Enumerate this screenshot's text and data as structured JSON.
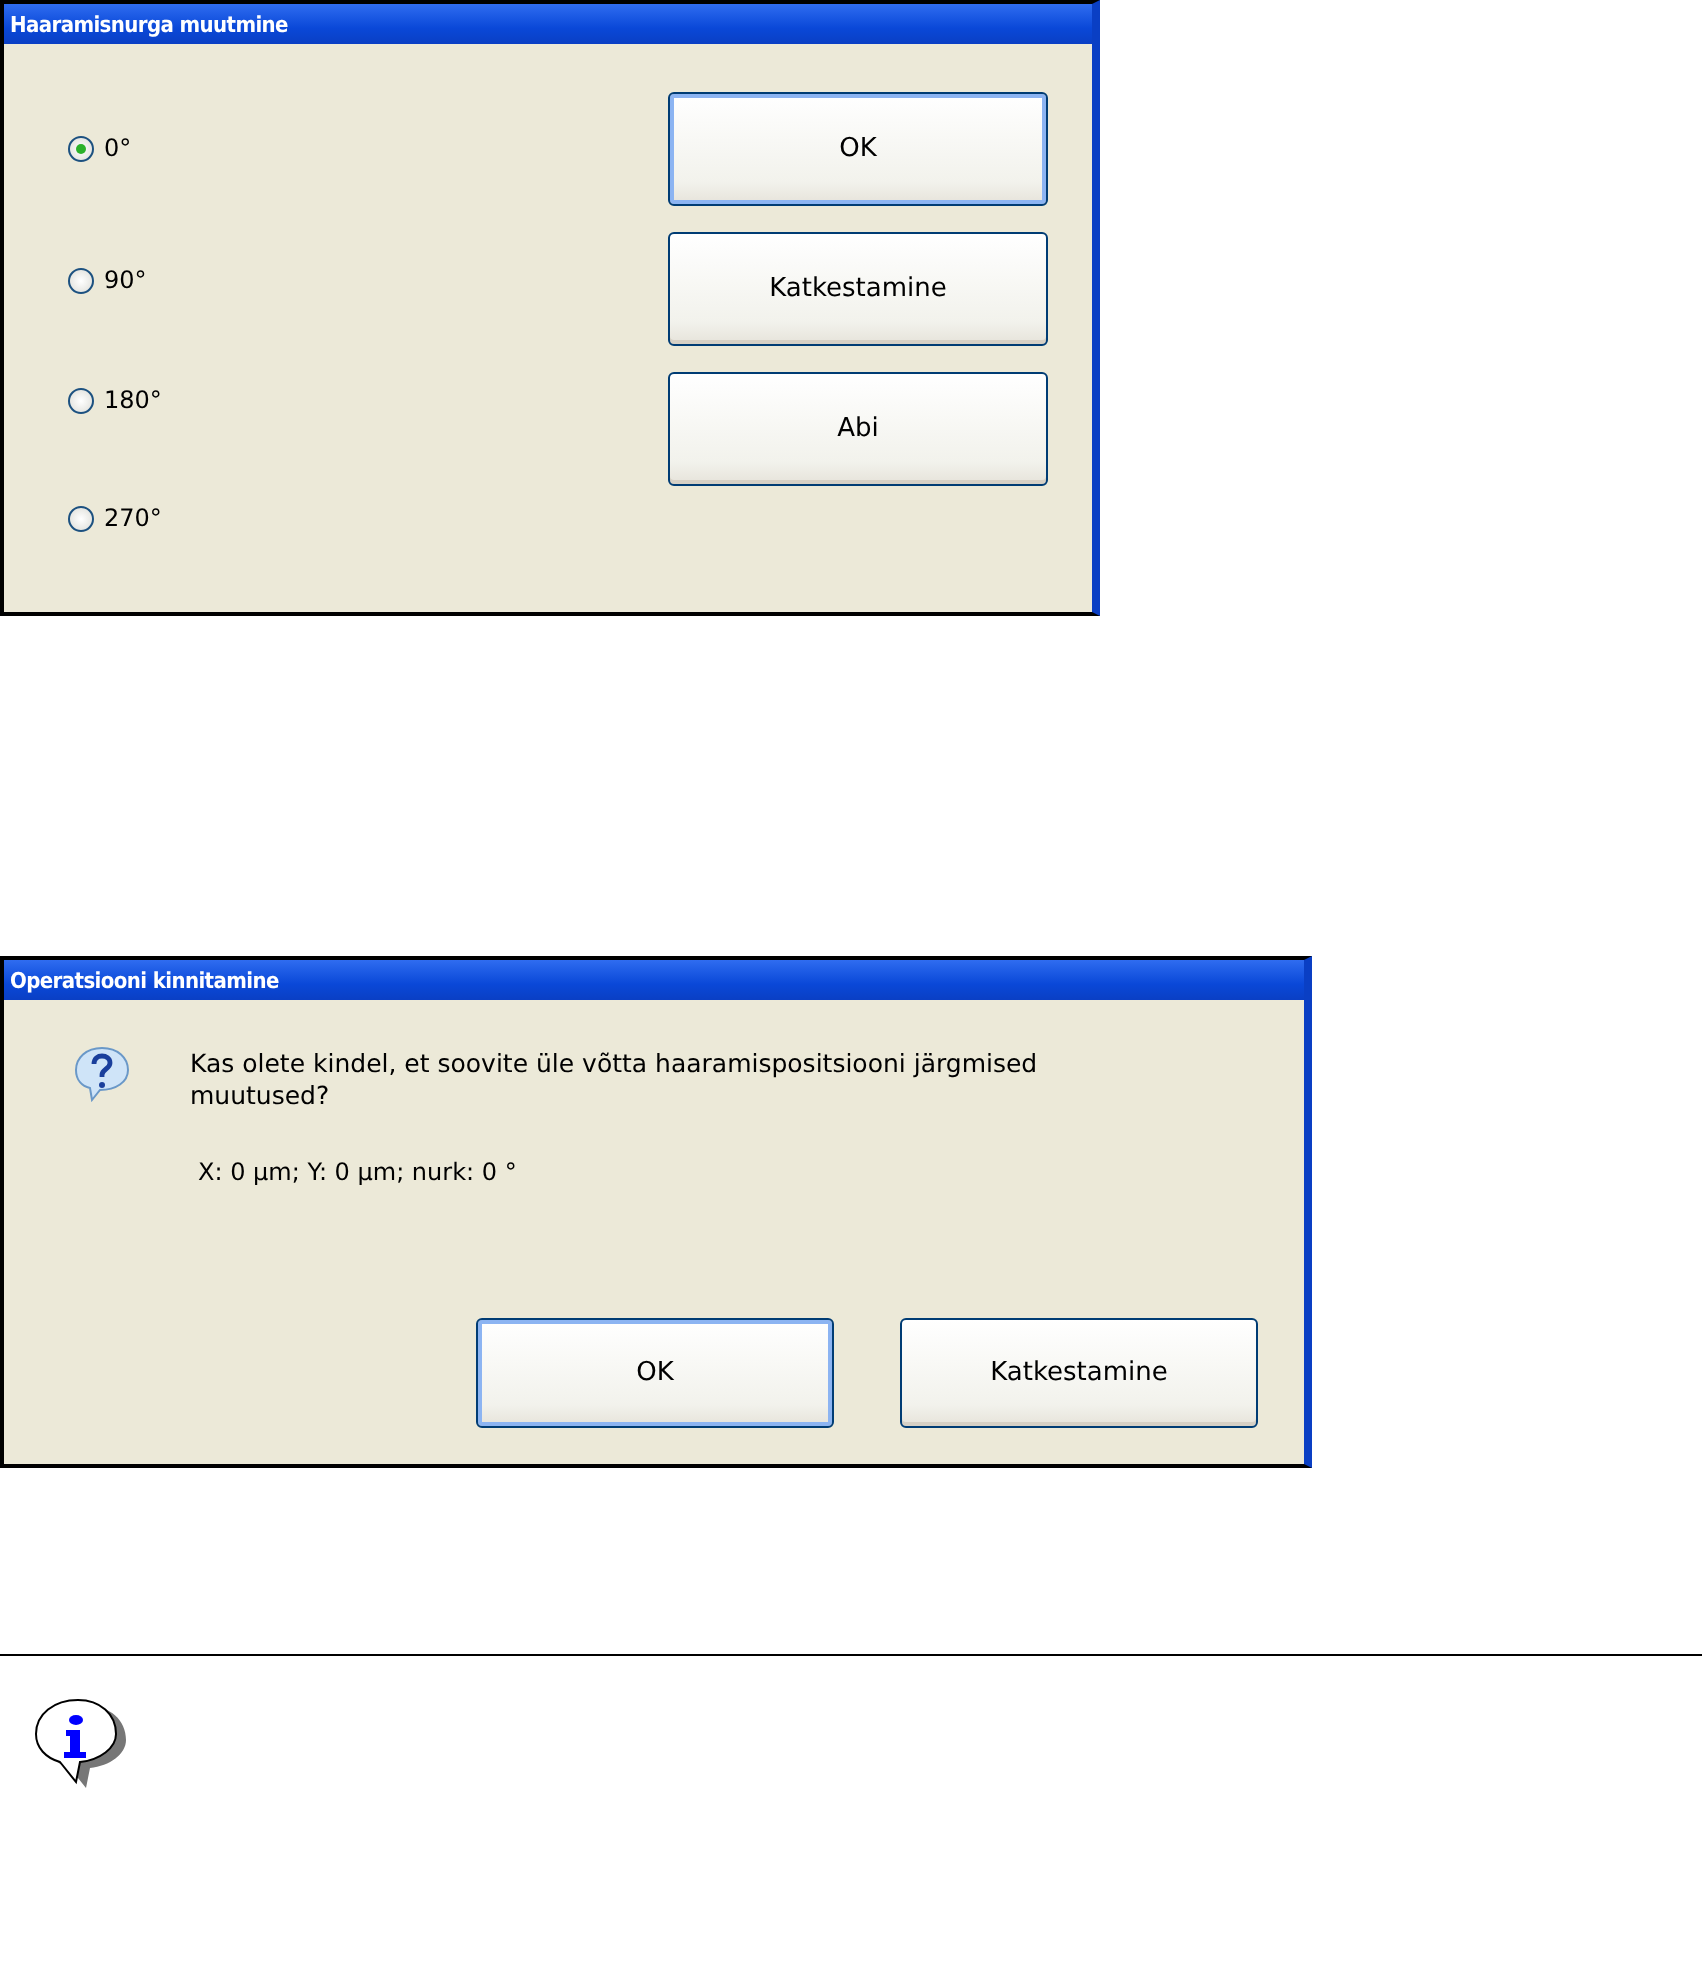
{
  "angle_dialog": {
    "title": "Haaramisnurga muutmine",
    "options": [
      {
        "label": "0°",
        "selected": true
      },
      {
        "label": "90°",
        "selected": false
      },
      {
        "label": "180°",
        "selected": false
      },
      {
        "label": "270°",
        "selected": false
      }
    ],
    "buttons": [
      {
        "label": "OK",
        "default": true
      },
      {
        "label": "Katkestamine",
        "default": false
      },
      {
        "label": "Abi",
        "default": false
      }
    ]
  },
  "confirm_dialog": {
    "title": "Operatsiooni kinnitamine",
    "message": "Kas olete kindel, et soovite üle võtta haaramispositsiooni järgmised muutused?",
    "values": "X: 0 µm;  Y: 0 µm;  nurk: 0 °",
    "buttons": [
      {
        "label": "OK",
        "default": true
      },
      {
        "label": "Katkestamine",
        "default": false
      }
    ]
  },
  "note": {
    "kind": "info"
  }
}
